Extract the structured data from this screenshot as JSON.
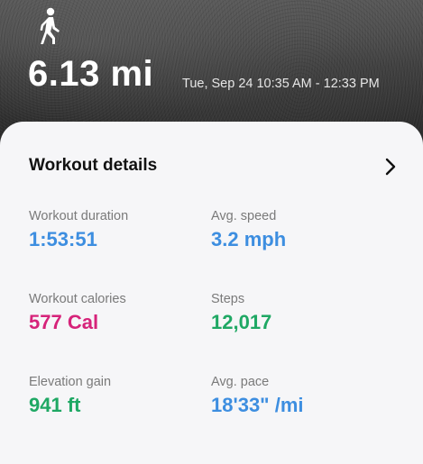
{
  "header": {
    "activity_icon": "walking-person-icon",
    "distance": "6.13 mi",
    "time_range": "Tue, Sep 24 10:35 AM - 12:33 PM"
  },
  "details": {
    "title": "Workout details",
    "chevron_icon": "chevron-right-icon",
    "stats": {
      "duration": {
        "label": "Workout duration",
        "value": "1:53:51",
        "color": "#3d8ee0"
      },
      "speed": {
        "label": "Avg. speed",
        "value": "3.2 mph",
        "color": "#3d8ee0"
      },
      "calories": {
        "label": "Workout calories",
        "value": "577 Cal",
        "color": "#d6237a"
      },
      "steps": {
        "label": "Steps",
        "value": "12,017",
        "color": "#1fa864"
      },
      "elevation": {
        "label": "Elevation gain",
        "value": "941 ft",
        "color": "#1fa864"
      },
      "pace": {
        "label": "Avg. pace",
        "value": "18'33\" /mi",
        "color": "#3d8ee0"
      }
    }
  }
}
